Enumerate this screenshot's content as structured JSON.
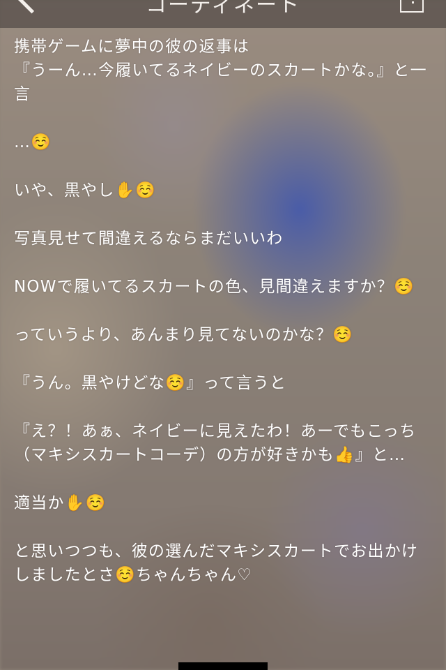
{
  "header": {
    "title": "コーディネート",
    "back_icon": "chevron-left-icon",
    "menu_icon": "menu-box-icon"
  },
  "body": {
    "paragraphs": [
      "携帯ゲームに夢中の彼の返事は\n『うーん…今履いてるネイビーのスカートかな。』と一言",
      "…☺️",
      "いや、黒やし✋☺️",
      "写真見せて間違えるならまだいいわ",
      "NOWで履いてるスカートの色、見間違えますか？☺️",
      "っていうより、あんまり見てないのかな？☺️",
      "『うん。黒やけどな☺️』って言うと",
      "『え？！あぁ、ネイビーに見えたわ！あーでもこっち（マキシスカートコーデ）の方が好きかも👍』と…",
      "適当か✋☺️",
      "と思いつつも、彼の選んだマキシスカートでお出かけしましたとさ☺️ちゃんちゃん♡"
    ]
  },
  "colors": {
    "text": "#ffffff",
    "header_overlay": "#3c3734"
  }
}
